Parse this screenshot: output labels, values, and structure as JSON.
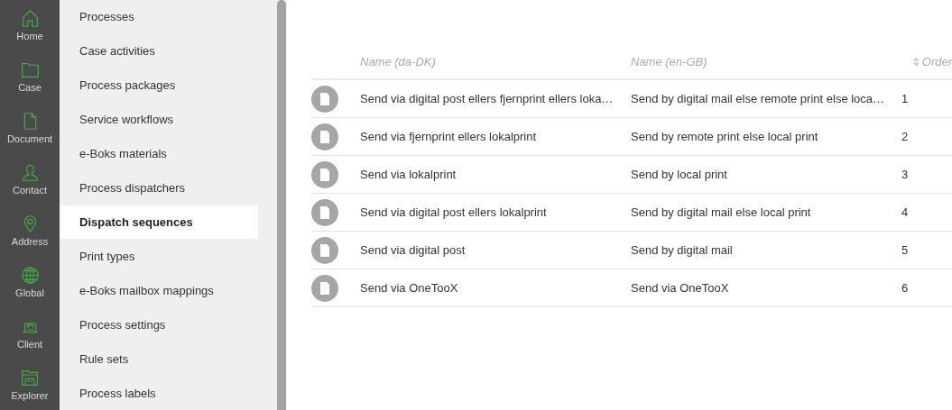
{
  "rail": [
    {
      "label": "Home",
      "kind": "home"
    },
    {
      "label": "Case",
      "kind": "folder"
    },
    {
      "label": "Document",
      "kind": "document"
    },
    {
      "label": "Contact",
      "kind": "person"
    },
    {
      "label": "Address",
      "kind": "pin"
    },
    {
      "label": "Global",
      "kind": "globe"
    },
    {
      "label": "Client",
      "kind": "client"
    },
    {
      "label": "Explorer",
      "kind": "explorer"
    }
  ],
  "menu": [
    {
      "label": "Processes",
      "selected": false
    },
    {
      "label": "Case activities",
      "selected": false
    },
    {
      "label": "Process packages",
      "selected": false
    },
    {
      "label": "Service workflows",
      "selected": false
    },
    {
      "label": "e-Boks materials",
      "selected": false
    },
    {
      "label": "Process dispatchers",
      "selected": false
    },
    {
      "label": "Dispatch sequences",
      "selected": true
    },
    {
      "label": "Print types",
      "selected": false
    },
    {
      "label": "e-Boks mailbox mappings",
      "selected": false
    },
    {
      "label": "Process settings",
      "selected": false
    },
    {
      "label": "Rule sets",
      "selected": false
    },
    {
      "label": "Process labels",
      "selected": false
    }
  ],
  "table": {
    "columns": [
      "Name (da-DK)",
      "Name (en-GB)",
      "Order"
    ],
    "rows": [
      [
        "Send via digital post ellers fjernprint ellers loka…",
        "Send by digital mail else remote print else loca…",
        "1"
      ],
      [
        "Send via fjernprint ellers lokalprint",
        "Send by remote print else local print",
        "2"
      ],
      [
        "Send via lokalprint",
        "Send by local print",
        "3"
      ],
      [
        "Send via digital post ellers lokalprint",
        "Send by digital mail else local print",
        "4"
      ],
      [
        "Send via digital post",
        "Send by digital mail",
        "5"
      ],
      [
        "Send via OneTooX",
        "Send via OneTooX",
        "6"
      ]
    ]
  }
}
